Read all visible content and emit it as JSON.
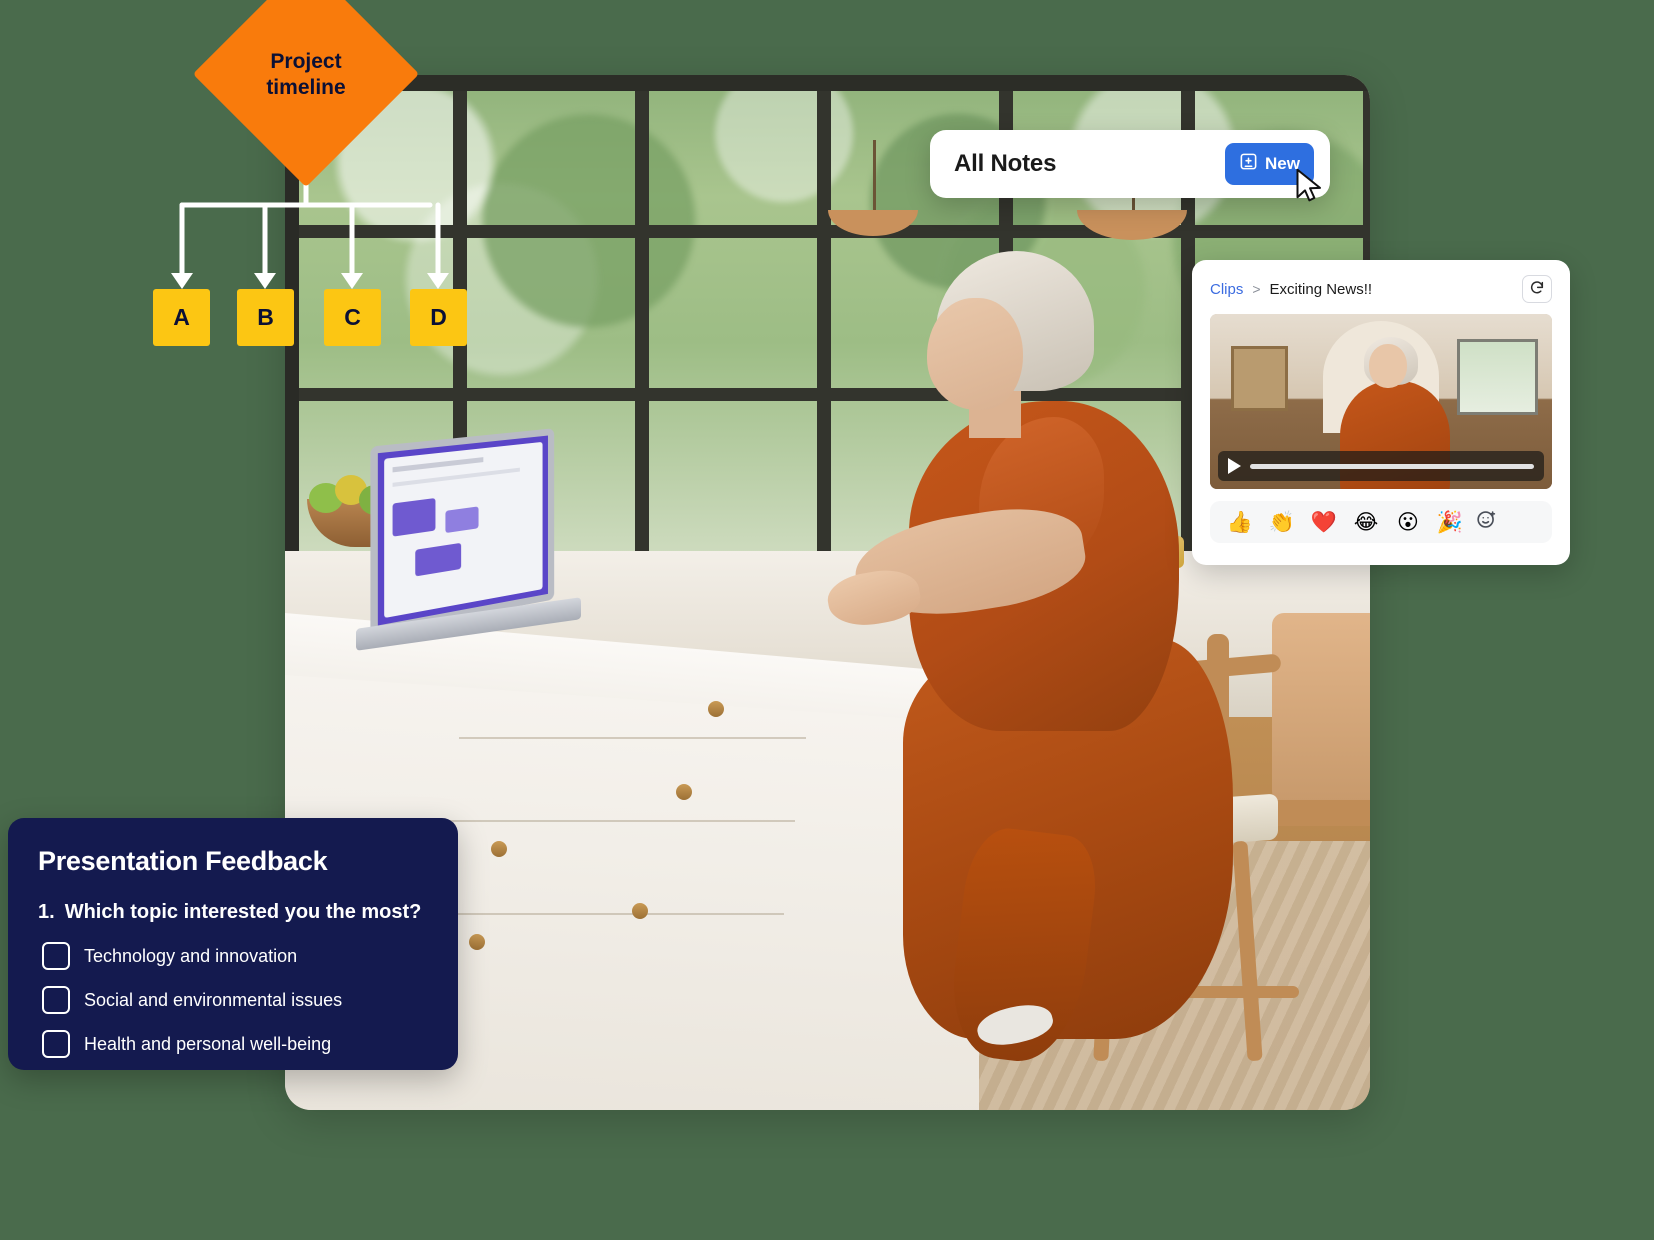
{
  "diagram": {
    "root_label_line1": "Project",
    "root_label_line2": "timeline",
    "root_shape": "diamond",
    "root_color": "#f97b0c",
    "node_color": "#fcc613",
    "nodes": [
      {
        "label": "A"
      },
      {
        "label": "B"
      },
      {
        "label": "C"
      },
      {
        "label": "D"
      }
    ]
  },
  "notes_panel": {
    "title": "All Notes",
    "new_button_label": "New",
    "new_button_icon": "note-add-icon",
    "accent": "#2e6fe0",
    "cursor_icon": "mouse-pointer-icon"
  },
  "clips_panel": {
    "breadcrumb_root": "Clips",
    "breadcrumb_separator": ">",
    "breadcrumb_current": "Exciting News!!",
    "refresh_icon": "refresh-icon",
    "link_color": "#3b6ce0",
    "video": {
      "play_icon": "play-icon",
      "progress_percent": 0
    },
    "reactions": [
      {
        "name": "thumbs-up-reaction",
        "glyph": "👍"
      },
      {
        "name": "clap-reaction",
        "glyph": "👏"
      },
      {
        "name": "heart-reaction",
        "glyph": "❤️"
      },
      {
        "name": "joy-reaction",
        "glyph": "😂"
      },
      {
        "name": "surprised-reaction",
        "glyph": "😮"
      },
      {
        "name": "party-popper-reaction",
        "glyph": "🎉"
      }
    ],
    "add_reaction_icon": "add-reaction-icon"
  },
  "feedback_card": {
    "title": "Presentation Feedback",
    "question_number": "1.",
    "question": "Which topic interested you the most?",
    "background": "#141a4f",
    "options": [
      {
        "label": "Technology and innovation"
      },
      {
        "label": "Social and environmental issues"
      },
      {
        "label": "Health and personal well-being"
      }
    ]
  }
}
